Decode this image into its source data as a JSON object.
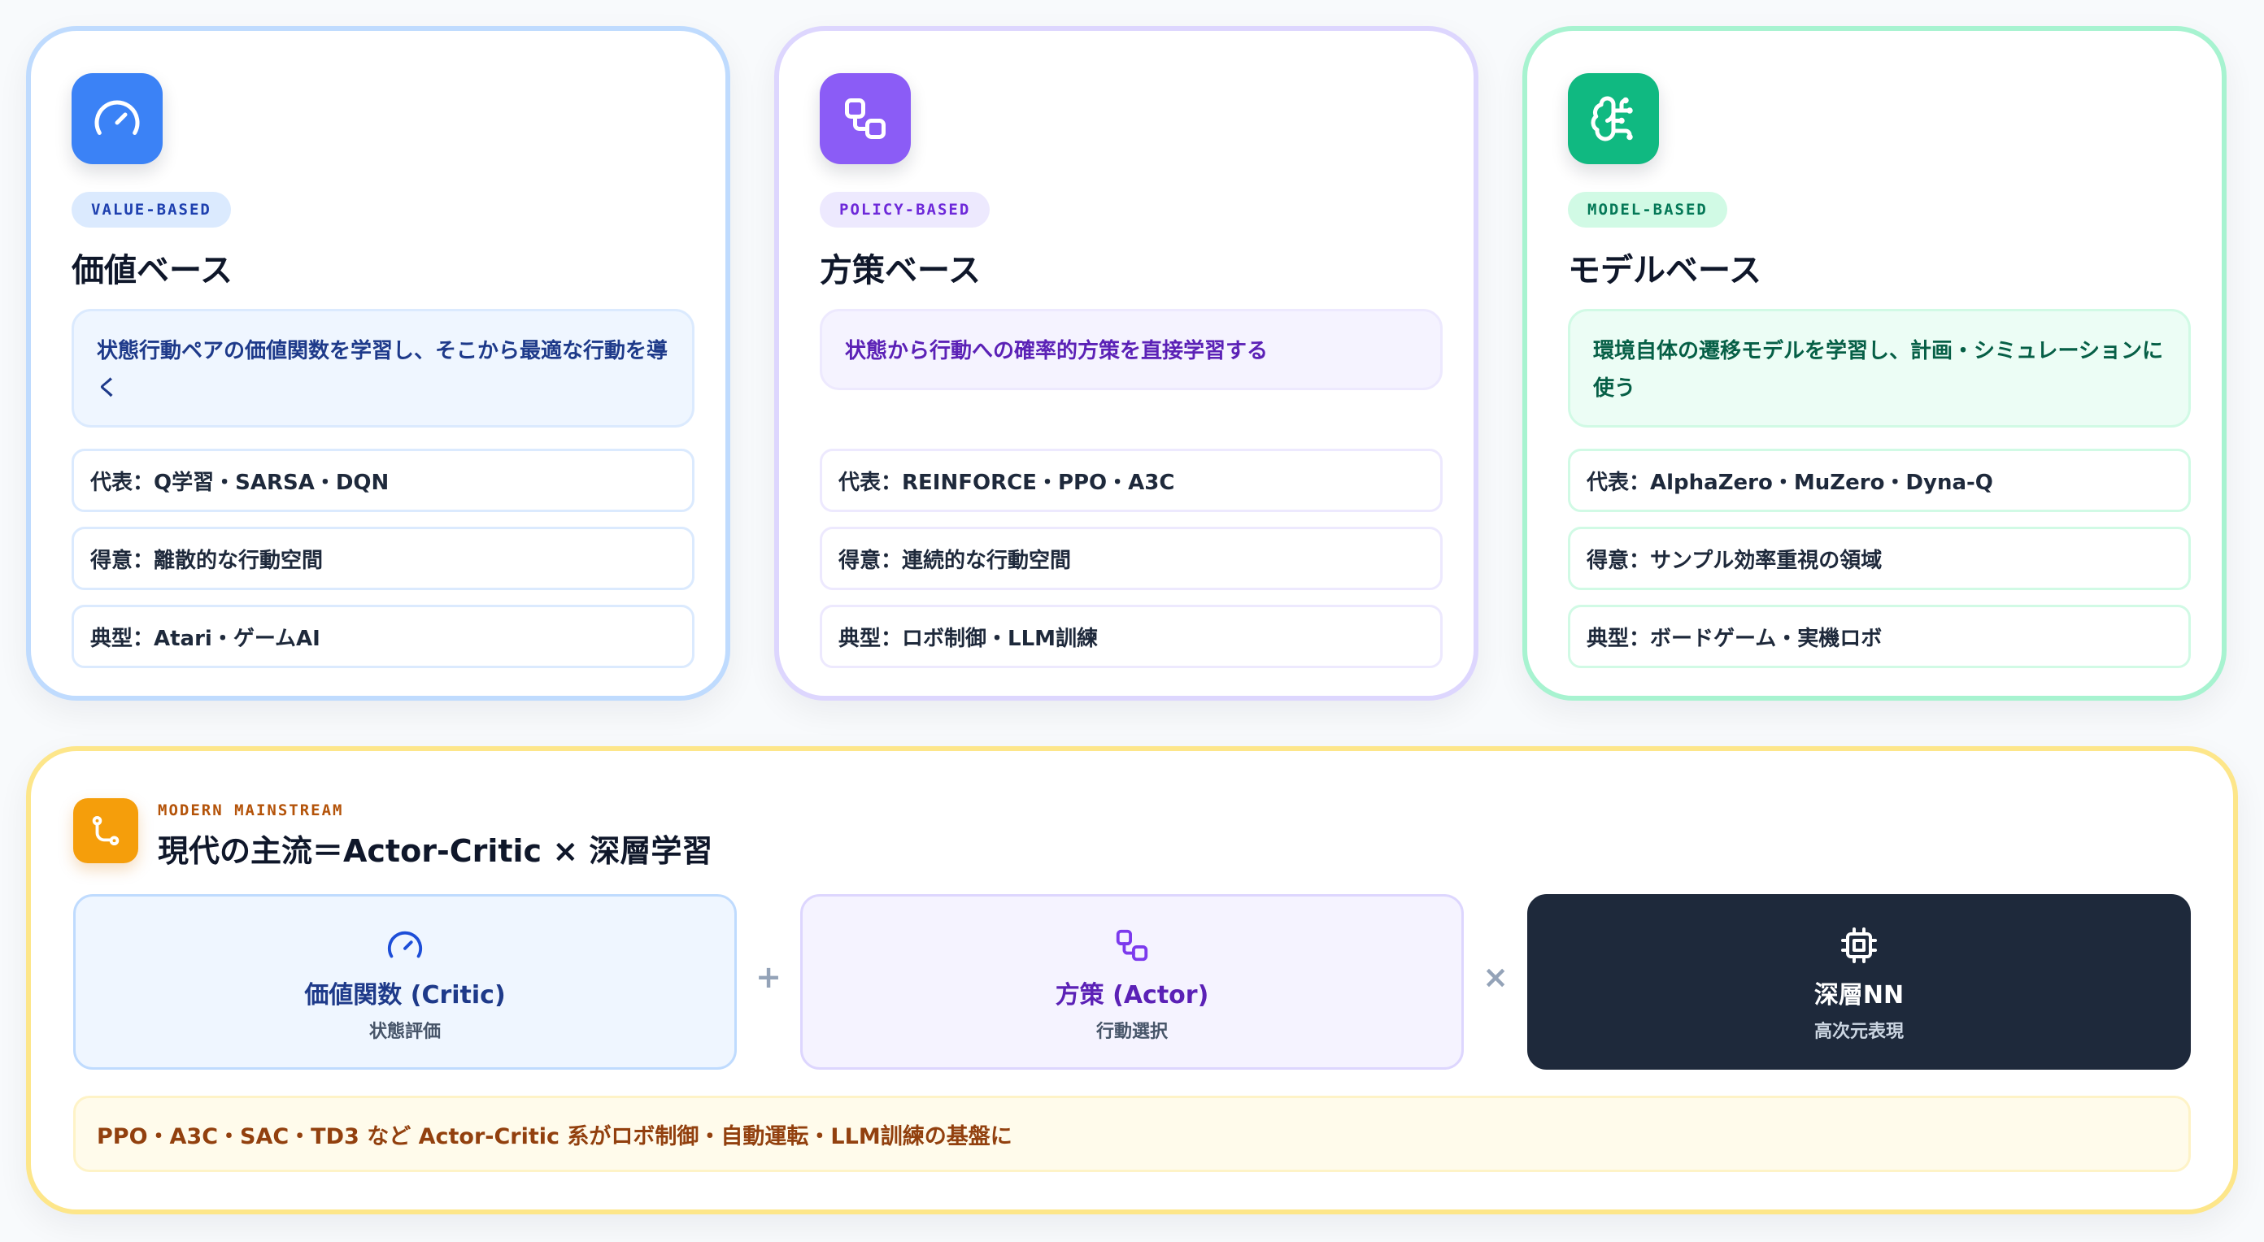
{
  "colors": {
    "value_accent": "#3b82f6",
    "policy_accent": "#8b5cf6",
    "model_accent": "#10b981",
    "mainstream_accent": "#f59e0b",
    "nn_dark": "#1e293b"
  },
  "cards": [
    {
      "icon": "gauge-icon",
      "tag": "VALUE-BASED",
      "title": "価値ベース",
      "description": "状態行動ペアの価値関数を学習し、そこから最適な行動を導く",
      "facts": [
        "代表：Q学習・SARSA・DQN",
        "得意：離散的な行動空間",
        "典型：Atari・ゲームAI"
      ]
    },
    {
      "icon": "workflow-icon",
      "tag": "POLICY-BASED",
      "title": "方策ベース",
      "description": "状態から行動への確率的方策を直接学習する",
      "facts": [
        "代表：REINFORCE・PPO・A3C",
        "得意：連続的な行動空間",
        "典型：ロボ制御・LLM訓練"
      ]
    },
    {
      "icon": "brain-icon",
      "tag": "MODEL-BASED",
      "title": "モデルベース",
      "description": "環境自体の遷移モデルを学習し、計画・シミュレーションに使う",
      "facts": [
        "代表：AlphaZero・MuZero・Dyna-Q",
        "得意：サンプル効率重視の領域",
        "典型：ボードゲーム・実機ロボ"
      ]
    }
  ],
  "mainstream": {
    "icon": "git-branch-icon",
    "eyebrow": "MODERN MAINSTREAM",
    "title": "現代の主流＝Actor-Critic × 深層学習",
    "components": [
      {
        "icon": "gauge-icon",
        "name": "価値関数 (Critic)",
        "sub": "状態評価"
      },
      {
        "icon": "workflow-icon",
        "name": "方策 (Actor)",
        "sub": "行動選択"
      },
      {
        "icon": "cpu-icon",
        "name": "深層NN",
        "sub": "高次元表現"
      }
    ],
    "operators": [
      "+",
      "×"
    ],
    "note": "PPO・A3C・SAC・TD3 など Actor-Critic 系がロボ制御・自動運転・LLM訓練の基盤に"
  }
}
